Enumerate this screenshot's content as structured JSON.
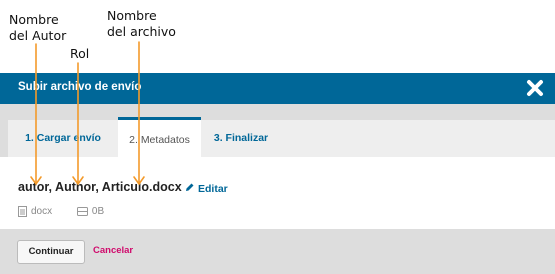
{
  "annotations": {
    "author_label_line1": "Nombre",
    "author_label_line2": "del Autor",
    "role_label": "Rol",
    "file_label_line1": "Nombre",
    "file_label_line2": "del archivo",
    "arrow_color": "#f39a2b"
  },
  "modal": {
    "title": "Subir archivo de envío",
    "header_color": "#006798",
    "close_icon": "close-x-icon"
  },
  "tabs": [
    {
      "label": "1. Cargar envío"
    },
    {
      "label": "2. Metadatos",
      "active": true
    },
    {
      "label": "3. Finalizar"
    }
  ],
  "file": {
    "name_line": "autor, Author, Articulo.docx",
    "edit_label": "Editar",
    "type": "docx",
    "size": "0B"
  },
  "footer": {
    "continue_label": "Continuar",
    "cancel_label": "Cancelar",
    "cancel_color": "#d00a6c"
  }
}
